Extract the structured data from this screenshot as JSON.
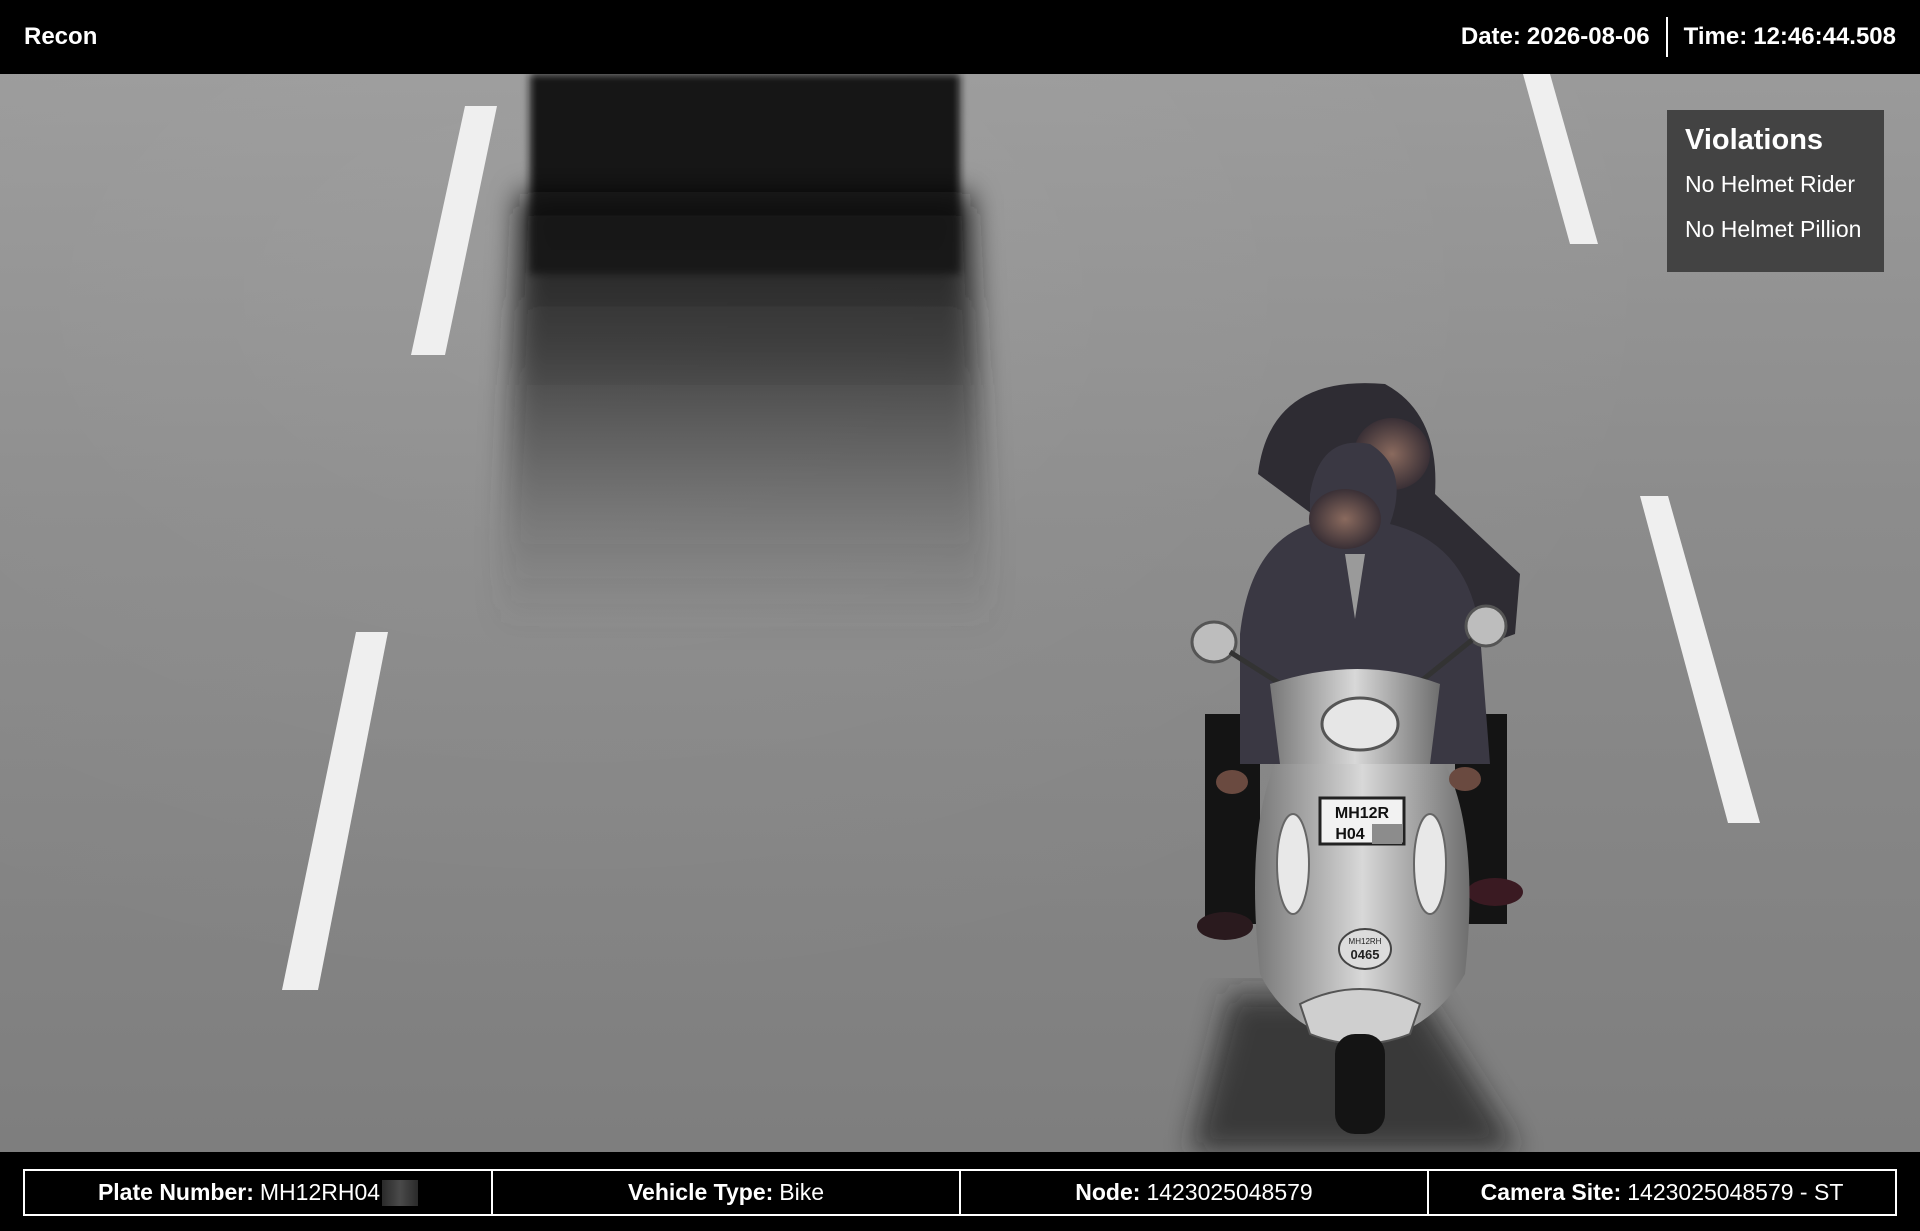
{
  "header": {
    "app_name": "Recon",
    "date_label": "Date:",
    "date_value": "2026-08-06",
    "time_label": "Time:",
    "time_value": "12:46:44.508"
  },
  "violations": {
    "title": "Violations",
    "items": [
      "No Helmet Rider",
      "No Helmet Pillion"
    ]
  },
  "scene": {
    "plate_line1": "MH12R",
    "plate_line2": "H04",
    "front_number_line1": "MH12RH",
    "front_number_line2": "0465"
  },
  "footer": {
    "plate_label": "Plate Number:",
    "plate_value": "MH12RH04",
    "vehicle_label": "Vehicle Type:",
    "vehicle_value": "Bike",
    "node_label": "Node:",
    "node_value": "1423025048579",
    "site_label": "Camera Site:",
    "site_value": "1423025048579 - ST"
  },
  "colors": {
    "road": "#8c8c8c",
    "lane_marking": "#f2f2f2",
    "panel": "#3c3c3c"
  }
}
